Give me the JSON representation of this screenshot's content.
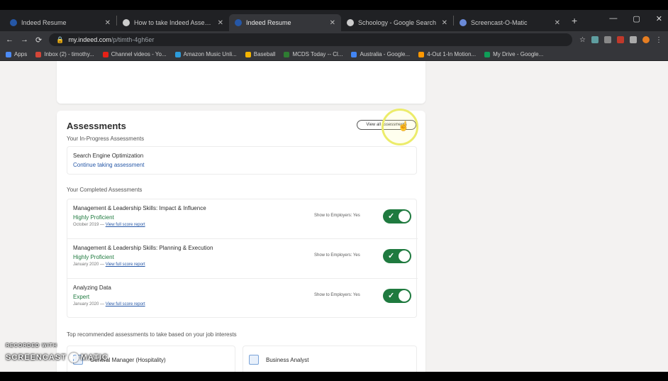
{
  "tabs": [
    {
      "title": "Indeed Resume",
      "color": "#2557a7",
      "active": false
    },
    {
      "title": "How to take Indeed Assessme...",
      "color": "#cccccc",
      "active": false
    },
    {
      "title": "Indeed Resume",
      "color": "#2557a7",
      "active": true
    },
    {
      "title": "Schoology - Google Search",
      "color": "#cccccc",
      "active": false
    },
    {
      "title": "Screencast-O-Matic",
      "color": "#6a8ad9",
      "active": false
    }
  ],
  "address": {
    "domain": "my.indeed.com",
    "path": "/p/timth-4gh6er"
  },
  "bookmarks": [
    {
      "label": "Apps",
      "color": "#4c8bf5"
    },
    {
      "label": "Inbox (2) - timothy...",
      "color": "#d44638"
    },
    {
      "label": "Channel videos - Yo...",
      "color": "#e62117"
    },
    {
      "label": "Amazon Music Unli...",
      "color": "#2c9cdb"
    },
    {
      "label": "Baseball",
      "color": "#f4b400"
    },
    {
      "label": "MCDS Today -- Cl...",
      "color": "#2e7d32"
    },
    {
      "label": "Australia - Google...",
      "color": "#4285f4"
    },
    {
      "label": "4-Out 1-In Motion...",
      "color": "#ff9800"
    },
    {
      "label": "My Drive - Google...",
      "color": "#0f9d58"
    }
  ],
  "assessments": {
    "title": "Assessments",
    "view_all": "View all assessments",
    "in_progress_label": "Your In-Progress Assessments",
    "in_progress": {
      "name": "Search Engine Optimization",
      "action": "Continue taking assessment"
    },
    "completed_label": "Your Completed Assessments",
    "completed": [
      {
        "name": "Management & Leadership Skills: Impact & Influence",
        "level": "Highly Proficient",
        "date": "October 2019 —",
        "link": "View full score report",
        "show": "Show to Employers: Yes"
      },
      {
        "name": "Management & Leadership Skills: Planning & Execution",
        "level": "Highly Proficient",
        "date": "January 2020 —",
        "link": "View full score report",
        "show": "Show to Employers: Yes"
      },
      {
        "name": "Analyzing Data",
        "level": "Expert",
        "date": "January 2020 —",
        "link": "View full score report",
        "show": "Show to Employers: Yes"
      }
    ],
    "recommended_label": "Top recommended assessments to take based on your job interests",
    "recommended": [
      "General Manager (Hospitality)",
      "Business Analyst"
    ]
  },
  "watermark": {
    "line1": "RECORDED WITH",
    "line2a": "SCREENCAST",
    "line2b": "MATIC"
  }
}
